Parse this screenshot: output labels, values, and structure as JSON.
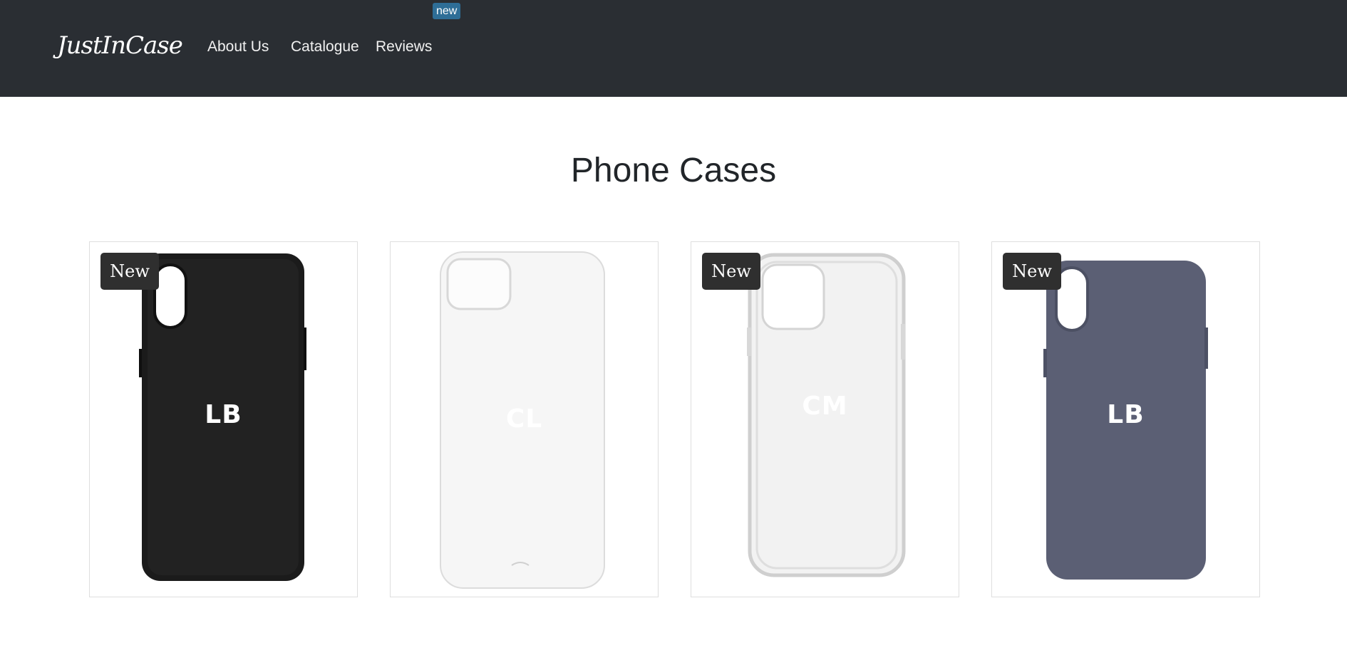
{
  "navbar": {
    "brand": "JustInCase",
    "links": [
      {
        "label": "About Us"
      },
      {
        "label": "Catalogue"
      },
      {
        "label": "Reviews",
        "badge": "new"
      }
    ]
  },
  "page": {
    "title": "Phone Cases"
  },
  "products": [
    {
      "badge": "New",
      "monogram": "LB",
      "case_color": "#1c1c1c"
    },
    {
      "badge": "",
      "monogram": "CL",
      "case_color": "#f4f4f4"
    },
    {
      "badge": "New",
      "monogram": "CM",
      "case_color": "#efefef"
    },
    {
      "badge": "New",
      "monogram": "LB",
      "case_color": "#5b5f74"
    }
  ]
}
